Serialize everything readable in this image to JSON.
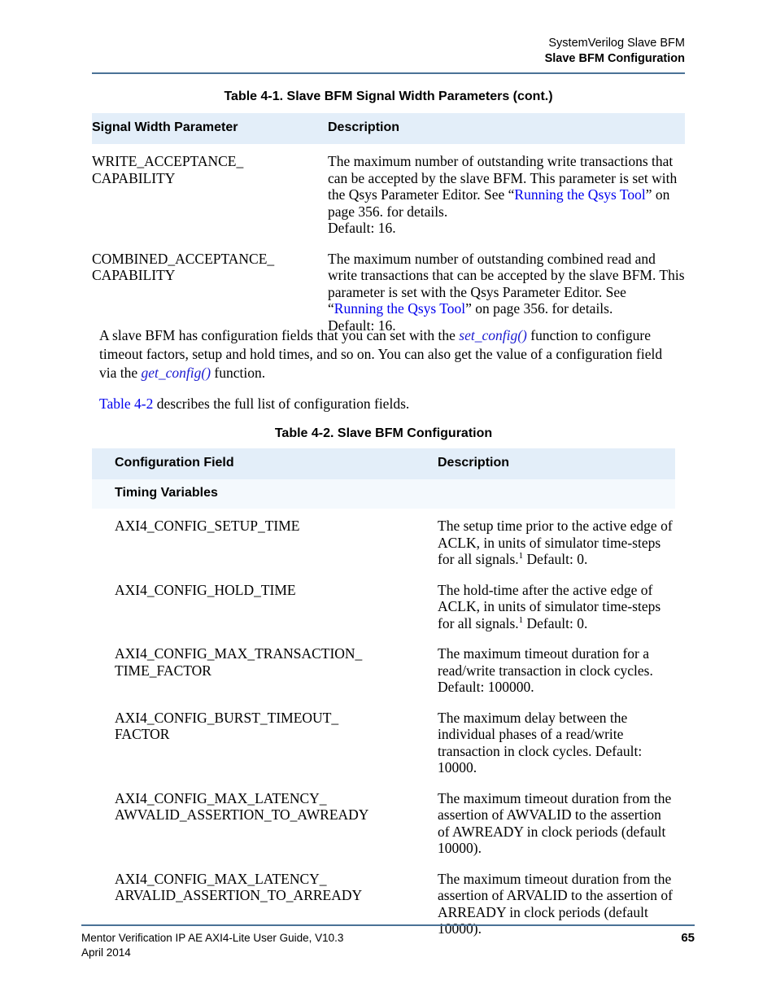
{
  "running_header": {
    "line1": "SystemVerilog Slave BFM",
    "line2": "Slave BFM Configuration"
  },
  "table1": {
    "caption": "Table 4-1. Slave BFM Signal Width Parameters (cont.)",
    "columns": [
      "Signal Width Parameter",
      "Description"
    ],
    "rows": [
      {
        "field": "WRITE_ACCEPTANCE_\nCAPABILITY",
        "desc_pre": "The maximum number of outstanding write transactions that can be accepted by the slave BFM. This parameter is set with the Qsys Parameter Editor. See “",
        "desc_link": "Running the Qsys Tool",
        "desc_post": "” on page 356. for details.",
        "desc_default": "Default: 16."
      },
      {
        "field": "COMBINED_ACCEPTANCE_\nCAPABILITY",
        "desc_pre": "The maximum number of outstanding combined read and write transactions that can be accepted by the slave BFM. This parameter is set with the Qsys Parameter Editor. See “",
        "desc_link": "Running the Qsys Tool",
        "desc_post": "” on page 356. for details.",
        "desc_default": "Default: 16."
      }
    ]
  },
  "paragraphs": {
    "p1_a": "A slave BFM has configuration fields that you can set with the ",
    "p1_fn1": "set_config()",
    "p1_b": " function to configure timeout factors, setup and hold times, and so on. You can also get the value of a configuration field via the ",
    "p1_fn2": "get_config()",
    "p1_c": " function.",
    "p2_link": "Table 4-2",
    "p2_rest": " describes the full list of configuration fields."
  },
  "table2": {
    "caption": "Table 4-2. Slave BFM Configuration",
    "columns": [
      "Configuration Field",
      "Description"
    ],
    "subheader": "Timing Variables",
    "rows": [
      {
        "field": "AXI4_CONFIG_SETUP_TIME",
        "desc_a": "The setup time prior to the active edge of ACLK, in units of simulator time-steps for all signals.",
        "desc_fn": "1",
        "desc_b": " Default: 0."
      },
      {
        "field": "AXI4_CONFIG_HOLD_TIME",
        "desc_a": "The hold-time after the active edge of ACLK, in units of simulator time-steps for all signals.",
        "desc_fn": "1",
        "desc_b": " Default: 0."
      },
      {
        "field": "AXI4_CONFIG_MAX_TRANSACTION_\nTIME_FACTOR",
        "desc_a": "The maximum timeout duration for a read/write transaction in clock cycles. Default: 100000.",
        "desc_fn": "",
        "desc_b": ""
      },
      {
        "field": "AXI4_CONFIG_BURST_TIMEOUT_\nFACTOR",
        "desc_a": "The maximum delay between the individual phases of a read/write transaction in clock cycles. Default: 10000.",
        "desc_fn": "",
        "desc_b": ""
      },
      {
        "field": "AXI4_CONFIG_MAX_LATENCY_\nAWVALID_ASSERTION_TO_AWREADY",
        "desc_a": "The maximum timeout duration from the assertion of AWVALID to the assertion of AWREADY in clock periods (default 10000).",
        "desc_fn": "",
        "desc_b": ""
      },
      {
        "field": "AXI4_CONFIG_MAX_LATENCY_\nARVALID_ASSERTION_TO_ARREADY",
        "desc_a": "The maximum timeout duration from the assertion of ARVALID to the assertion of ARREADY in clock periods (default 10000).",
        "desc_fn": "",
        "desc_b": ""
      }
    ]
  },
  "footer": {
    "left_line1": "Mentor Verification IP AE AXI4-Lite User Guide, V10.3",
    "left_line2": "April 2014",
    "page_number": "65"
  },
  "colors": {
    "rule": "#4a7296",
    "header_band": "#e3eef9",
    "subheader_band": "#f4f9fd",
    "link": "#0000ee"
  }
}
